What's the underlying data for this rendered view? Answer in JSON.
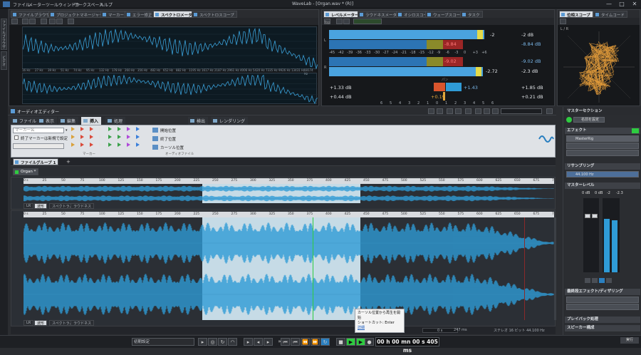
{
  "app": {
    "title": "WaveLab - [Organ.wav * (R)]",
    "menu": [
      "ファイル",
      "メーター",
      "ツールウィンドウ",
      "ワークスペース",
      "ヘルプ"
    ],
    "window_buttons": [
      "—",
      "□",
      "✕"
    ]
  },
  "left_tabs": [
    "ファイルブラウザー",
    "ビデオ"
  ],
  "top_left_panel": {
    "tabs": [
      "ファイルブラウザー",
      "プロジェクトマネージャー",
      "マーカー",
      "エラー修正",
      "スペクトロメーター",
      "スペクトロスコープ"
    ],
    "active_tab": "スペクトロメーター",
    "freq_labels": [
      "16 Hz",
      "27 Hz",
      "39 Hz",
      "51 Hz",
      "74 Hz",
      "95 Hz",
      "132 Hz",
      "178 Hz",
      "260 Hz",
      "356 Hz",
      "482 Hz",
      "652 Hz",
      "882 Hz",
      "1195 Hz",
      "1617 Hz",
      "2187 Hz",
      "2961 Hz",
      "4006 Hz",
      "5420 Hz",
      "7335 Hz",
      "9926 Hz",
      "13431 Hz",
      "18174 Hz"
    ]
  },
  "level_panel": {
    "tabs": [
      "レベルメーター",
      "ラウドネスメーター",
      "オシロスコープ",
      "ウェーブスコープ",
      "タスク"
    ],
    "active_tab": "レベルメーター",
    "labels": [
      "Top",
      "L",
      "R"
    ],
    "scale": [
      "-45",
      "-42",
      "-39",
      "-36",
      "-33",
      "-30",
      "-27",
      "-24",
      "-21",
      "-18",
      "-15",
      "-12",
      "-9",
      "-6",
      "-3",
      "0",
      "+3",
      "+6"
    ],
    "channel_L": {
      "peak": "-2",
      "rms": "-8.84",
      "peak_db": "-2 dB",
      "rms_db": "-8.84 dB",
      "peak_level": 0.93,
      "rms_level": 0.82
    },
    "channel_R": {
      "peak": "-2.72",
      "rms": "-9.02",
      "peak_db": "-2.3 dB",
      "rms_db": "-9.02 dB",
      "peak_level": 0.92,
      "rms_level": 0.81
    },
    "pan_label": "パン",
    "pan_values": [
      "+1.33 dB",
      "+0.44 dB",
      "+1.43",
      "+0.19",
      "+1.85 dB",
      "+0.21 dB"
    ],
    "pan_scale": [
      "6",
      "5",
      "4",
      "3",
      "2",
      "1",
      "0",
      "1",
      "2",
      "3",
      "4",
      "5",
      "6"
    ]
  },
  "phase_panel": {
    "tabs": [
      "位相スコープ",
      "タイムコード"
    ],
    "active_tab": "位相スコープ",
    "label": "L / R"
  },
  "editor": {
    "title": "オーディオエディター",
    "ribbon_tabs": [
      "ファイル",
      "表示",
      "編集",
      "挿入",
      "処理",
      "検出",
      "レンダリング"
    ],
    "active_ribbon": "挿入",
    "marker_name_placeholder": "マーカー名",
    "end_marker_label": "終了マーカーは新規で設定",
    "marker_group": "マーカー",
    "audio_file_group": "オーディオファイル",
    "start_pos": "開始位置",
    "end_pos": "終了位置",
    "cursor_pos": "カーソル位置",
    "file_group_tab": "ファイルグループ 1",
    "file_tab": "Organ *",
    "ruler_marks": [
      "0 s",
      "25",
      "50",
      "75",
      "100",
      "125",
      "150",
      "175",
      "200",
      "225",
      "250",
      "275",
      "300",
      "325",
      "350",
      "375",
      "400",
      "425",
      "450",
      "475",
      "500",
      "525",
      "550",
      "575",
      "600",
      "625",
      "650",
      "675",
      "700"
    ],
    "lane_tabs": [
      "LR",
      "波形",
      "スペクトラム",
      "ラウドネス"
    ],
    "status_zoom": "0 s",
    "status_len": "247 ms",
    "status_format": "ステレオ 16 ビット 44.100 Hz"
  },
  "tooltip": {
    "line1": "カーソル位置から再生を開始",
    "line2": "ショートカット: Enter",
    "link": "詳細"
  },
  "transport": {
    "preset": "初期設定",
    "timecode": "00 h 00 mn 00 s 405 ms"
  },
  "master": {
    "title": "マスターセクション",
    "preset_label": "名前を設定",
    "effects_header": "エフェクト",
    "effect_slot": "MasterRig",
    "resample_header": "リサンプリング",
    "resample_value": "44.100 Hz",
    "level_header": "マスターレベル",
    "level_values": [
      "0 dB",
      "0 dB",
      "-2",
      "-2.3"
    ],
    "final_header": "最終段エフェクト/ディザリング",
    "playback_header": "プレイバック処理",
    "speaker_header": "スピーカー構成",
    "render_button": "実行",
    "meter_levels": [
      0.72,
      0.7
    ]
  },
  "colors": {
    "wave": "#2f9bd6",
    "selection": "#c6dbe6",
    "accent_green": "#2ecc40",
    "level_blue": "#5aa8e0",
    "level_yellow": "#d9d24a"
  }
}
